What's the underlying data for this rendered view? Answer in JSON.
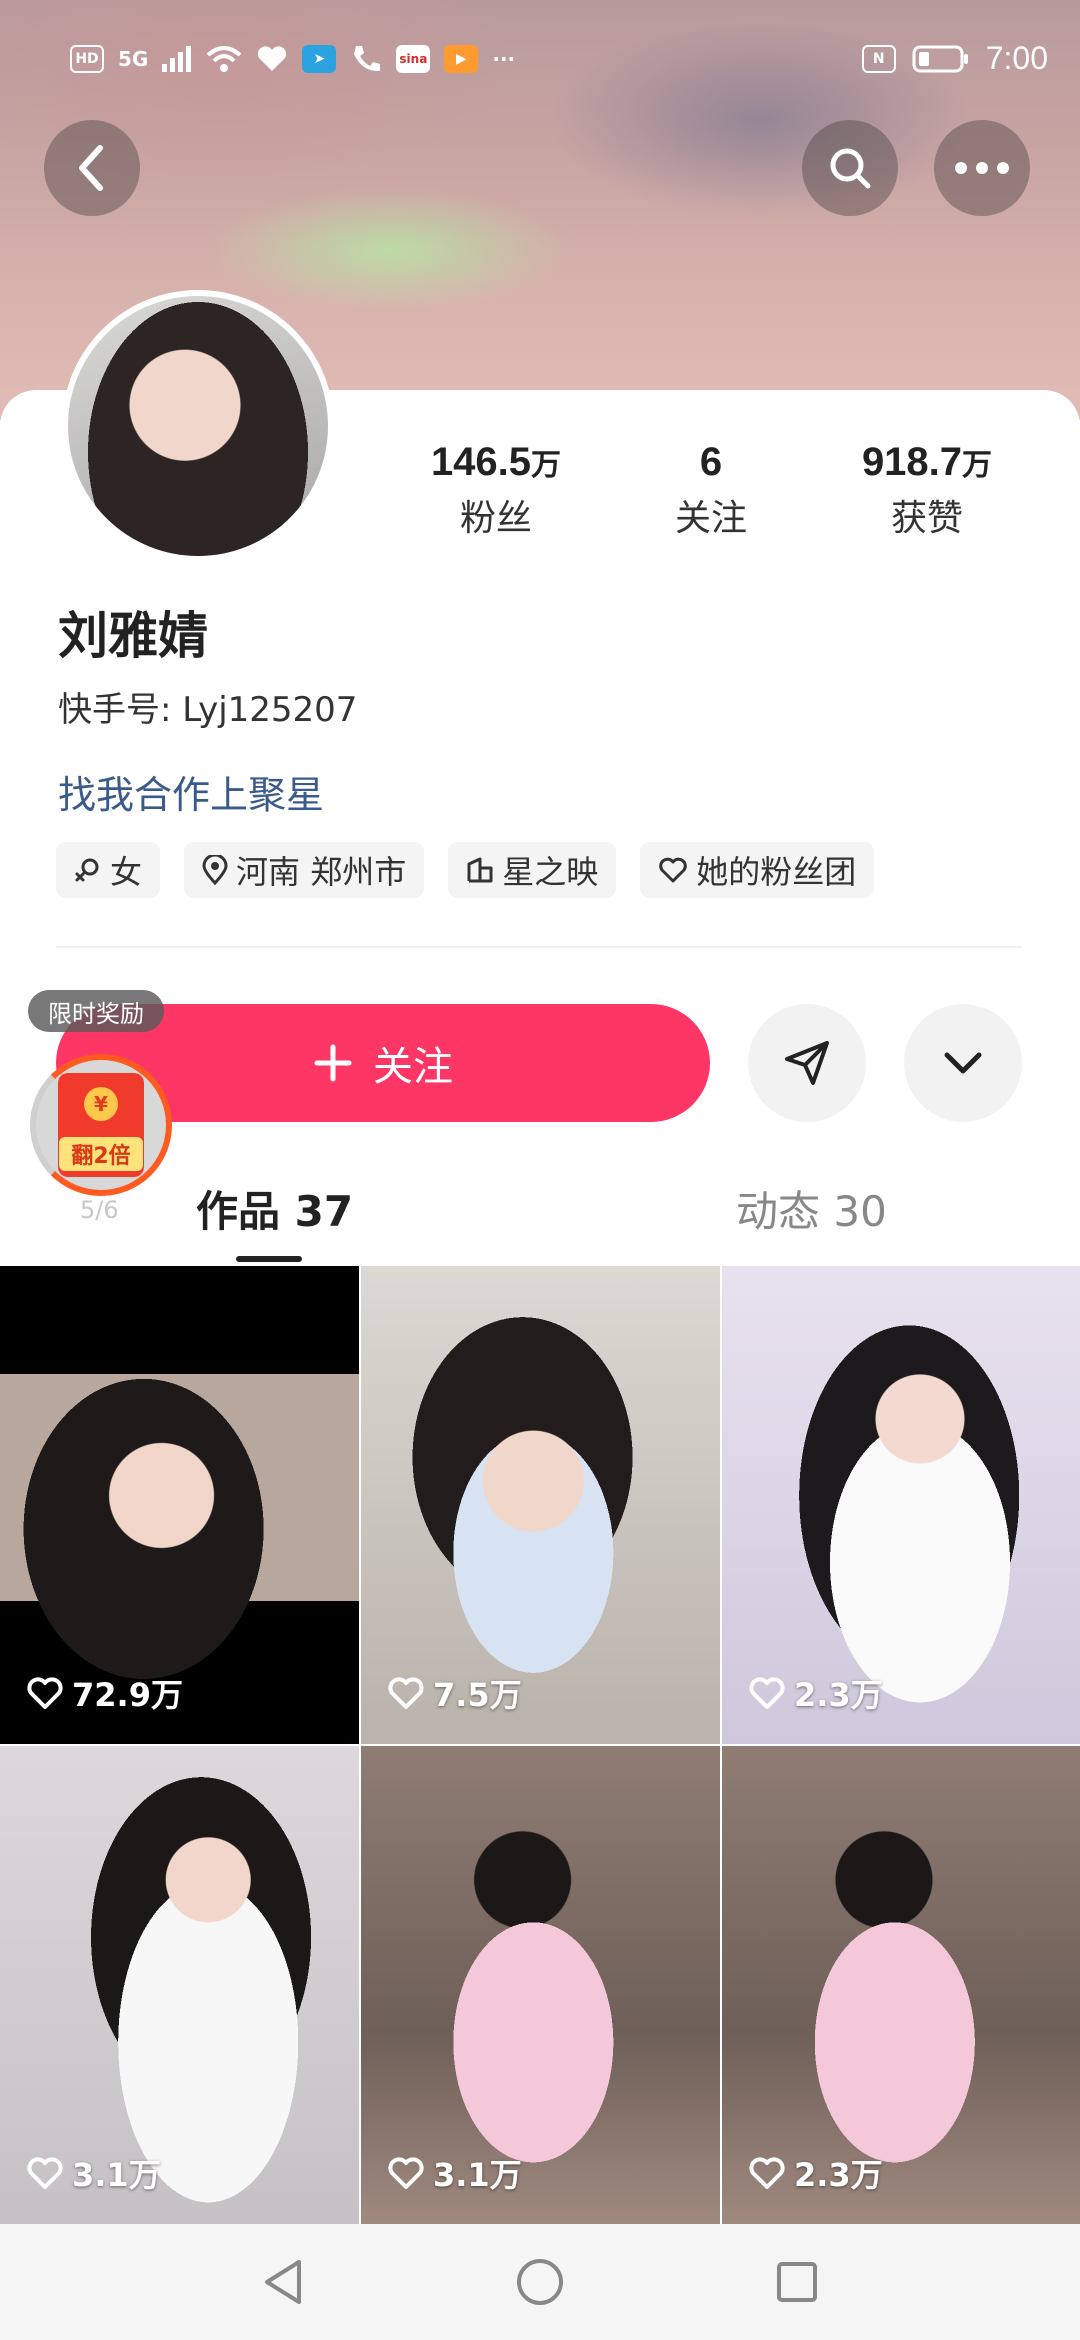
{
  "status_bar": {
    "left_badges": [
      "HD",
      "5G"
    ],
    "time": "7:00",
    "icons": [
      "hd-icon",
      "signal-icon",
      "wifi-icon",
      "health-icon",
      "telegram-icon",
      "call-icon",
      "sina-icon",
      "play-icon",
      "more-dots-icon",
      "nfc-icon",
      "battery-icon"
    ]
  },
  "header": {
    "back_icon": "chevron-left-icon",
    "search_icon": "search-icon",
    "more_icon": "more-dots-icon"
  },
  "profile": {
    "name": "刘雅婧",
    "kuaishou_id": "快手号: Lyj125207",
    "cooperation_link": "找我合作上聚星",
    "stats": [
      {
        "number": "146.5",
        "unit": "万",
        "label": "粉丝"
      },
      {
        "number": "6",
        "unit": "",
        "label": "关注"
      },
      {
        "number": "918.7",
        "unit": "万",
        "label": "获赞"
      }
    ],
    "tags": [
      {
        "icon": "female-icon",
        "label": "女"
      },
      {
        "icon": "location-icon",
        "label": "河南 郑州市"
      },
      {
        "icon": "agency-icon",
        "label": "星之映"
      },
      {
        "icon": "heart-outline-icon",
        "label": "她的粉丝团"
      }
    ]
  },
  "actions": {
    "follow_label": "关注",
    "follow_icon": "plus-icon",
    "share_icon": "send-icon",
    "expand_icon": "chevron-down-icon"
  },
  "reward": {
    "label": "限时奖励",
    "badge_text": "翻2倍",
    "coin_symbol": "¥",
    "progress": "5/6"
  },
  "tabs": [
    {
      "label": "作品 37",
      "active": true
    },
    {
      "label": "动态 30",
      "active": false
    }
  ],
  "videos": [
    {
      "likes": "72.9万"
    },
    {
      "likes": "7.5万"
    },
    {
      "likes": "2.3万"
    },
    {
      "likes": "3.1万"
    },
    {
      "likes": "3.1万"
    },
    {
      "likes": "2.3万"
    }
  ],
  "nav_bar": [
    "back-triangle-icon",
    "home-circle-icon",
    "recents-square-icon"
  ],
  "colors": {
    "accent": "#fe3666",
    "link": "#3a5a8c",
    "reward_ring": "#ff5a1f"
  }
}
